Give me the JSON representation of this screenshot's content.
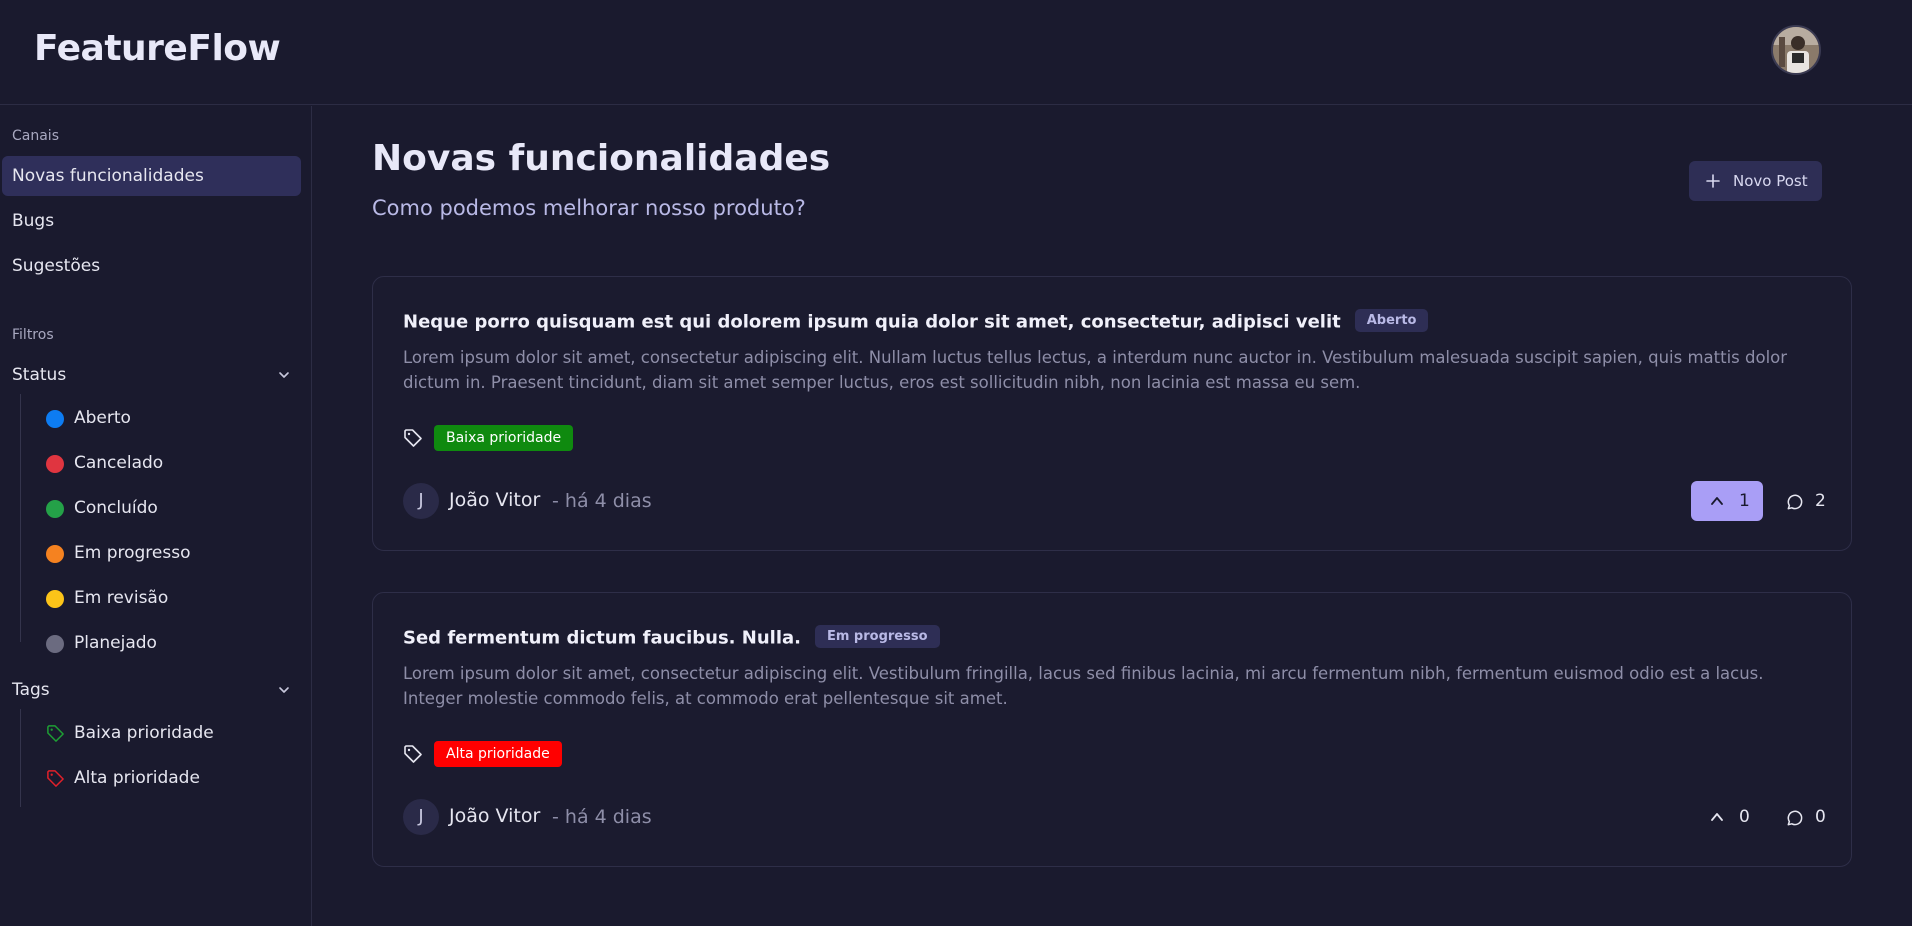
{
  "app": {
    "logo": "FeatureFlow"
  },
  "sidebar": {
    "channels_label": "Canais",
    "channels": [
      {
        "label": "Novas funcionalidades",
        "active": true
      },
      {
        "label": "Bugs",
        "active": false
      },
      {
        "label": "Sugestões",
        "active": false
      }
    ],
    "filters_label": "Filtros",
    "status": {
      "label": "Status",
      "items": [
        {
          "label": "Aberto",
          "color": "#0d7cf2"
        },
        {
          "label": "Cancelado",
          "color": "#e03540"
        },
        {
          "label": "Concluído",
          "color": "#24a148"
        },
        {
          "label": "Em progresso",
          "color": "#f58220"
        },
        {
          "label": "Em revisão",
          "color": "#fcc419"
        },
        {
          "label": "Planejado",
          "color": "#6b6b80"
        }
      ]
    },
    "tags": {
      "label": "Tags",
      "items": [
        {
          "label": "Baixa prioridade",
          "color": "#1e9e34"
        },
        {
          "label": "Alta prioridade",
          "color": "#e0202a"
        }
      ]
    }
  },
  "main": {
    "title": "Novas funcionalidades",
    "subtitle": "Como podemos melhorar nosso produto?",
    "new_post_label": "Novo Post",
    "posts": [
      {
        "title": "Neque porro quisquam est qui dolorem ipsum quia dolor sit amet, consectetur, adipisci velit",
        "status": "Aberto",
        "description": "Lorem ipsum dolor sit amet, consectetur adipiscing elit. Nullam luctus tellus lectus, a interdum nunc auctor in. Vestibulum malesuada suscipit sapien, quis mattis dolor dictum in. Praesent tincidunt, diam sit amet semper luctus, eros est sollicitudin nibh, non lacinia est massa eu sem.",
        "tag": "Baixa prioridade",
        "tag_color": "#0f8a0f",
        "author_initial": "J",
        "author": "João Vitor",
        "time": "- há 4 dias",
        "votes": "1",
        "voted": true,
        "comments": "2"
      },
      {
        "title": "Sed fermentum dictum faucibus. Nulla.",
        "status": "Em progresso",
        "description": "Lorem ipsum dolor sit amet, consectetur adipiscing elit. Vestibulum fringilla, lacus sed finibus lacinia, mi arcu fermentum nibh, fermentum euismod odio est a lacus. Integer molestie commodo felis, at commodo erat pellentesque sit amet.",
        "tag": "Alta prioridade",
        "tag_color": "#ff0000",
        "author_initial": "J",
        "author": "João Vitor",
        "time": "- há 4 dias",
        "votes": "0",
        "voted": false,
        "comments": "0"
      }
    ]
  }
}
